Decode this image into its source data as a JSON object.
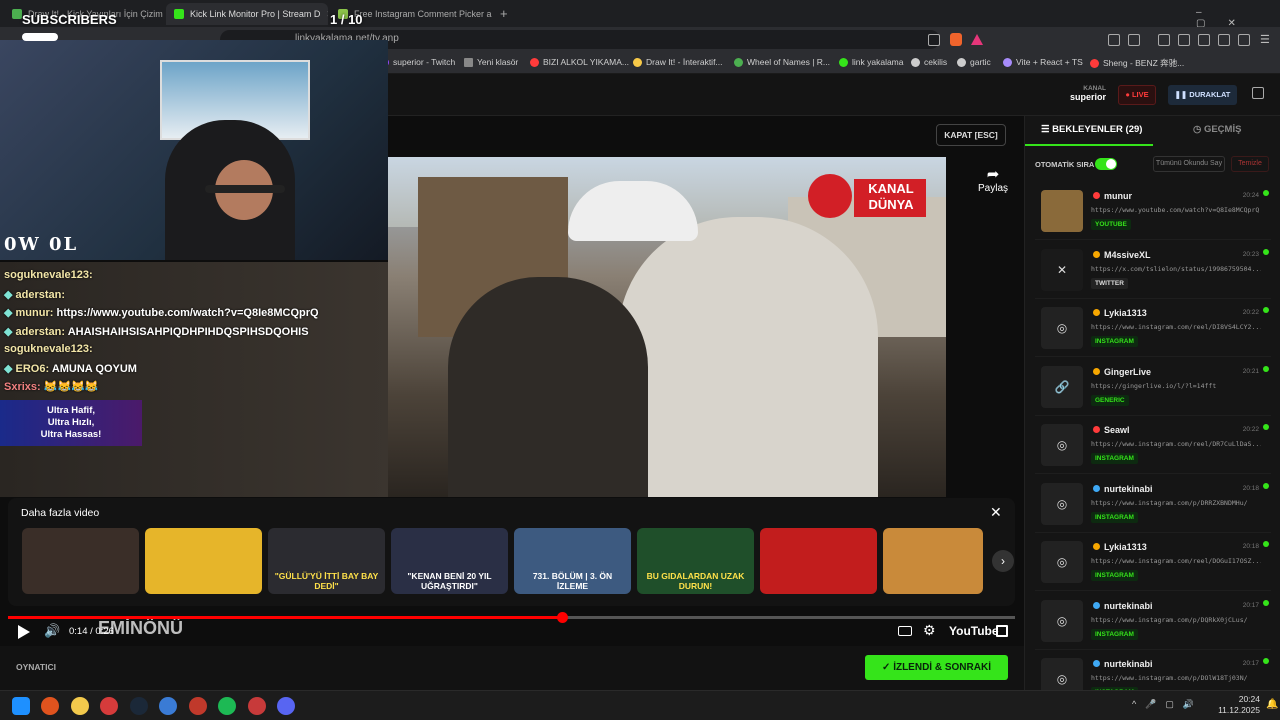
{
  "browser": {
    "tabs": [
      {
        "label": "Draw It! - Kick Yayınları İçin Çizim ve"
      },
      {
        "label": "Kick Link Monitor Pro | Stream D"
      },
      {
        "label": "Free Instagram Comment Picker and"
      }
    ],
    "new_tab": "+",
    "url": "linkyakalama.net/tv.anp",
    "bookmarks": [
      {
        "label": "superior - Twitch",
        "color": "#9146ff"
      },
      {
        "label": "Yeni klasör",
        "color": "#888888"
      },
      {
        "label": "BIZI ALKOL YIKAMA...",
        "color": "#ff3b3b"
      },
      {
        "label": "Draw It! - İnteraktif...",
        "color": "#f7c948"
      },
      {
        "label": "Wheel of Names | R...",
        "color": "#4caf50"
      },
      {
        "label": "link yakalama",
        "color": "#35e41a"
      },
      {
        "label": "cekilis",
        "color": "#cccccc"
      },
      {
        "label": "gartic",
        "color": "#cccccc"
      },
      {
        "label": "Vite + React + TS",
        "color": "#a78bfa"
      },
      {
        "label": "Sheng - BENZ 奔驰...",
        "color": "#ff3b3b"
      }
    ]
  },
  "overlay": {
    "subscribers_label": "SUBSCRIBERS",
    "subscribers_count": "1 / 10",
    "streamer_tag": "0W 0L",
    "chat": [
      {
        "user": "soguknevale123:",
        "msg": ""
      },
      {
        "user": "aderstan:",
        "msg": ""
      },
      {
        "user": "munur:",
        "msg": "https://www.youtube.com/watch?v=Q8Ie8MCQprQ"
      },
      {
        "user": "aderstan:",
        "msg": "AHAISHAIHSISAHPIQDHPIHDQSPIHSDQOHIS"
      },
      {
        "user": "soguknevale123:",
        "msg": ""
      },
      {
        "user": "ERO6:",
        "msg": "AMUNA QOYUM"
      },
      {
        "user": "Sxrixs:",
        "msg": "😹😹😹😹"
      }
    ],
    "promo": [
      "Ultra Hafif,",
      "Ultra Hızlı,",
      "Ultra Hassas!"
    ]
  },
  "header": {
    "channel_label": "KANAL",
    "channel_name": "superior",
    "live_label": "LIVE",
    "pause_label": "DURAKLAT"
  },
  "player": {
    "close_label": "KAPAT [ESC]",
    "share_label": "Paylaş",
    "video_logo": "KANAL DÜNYA",
    "more_videos_title": "Daha fazla video",
    "thumbnails": [
      {
        "text": "",
        "color": "#3a2e28"
      },
      {
        "text": "",
        "color": "#e6b52a"
      },
      {
        "text": "\"GÜLLÜ'YÜ İTTİ BAY BAY DEDİ\"",
        "color": "#2b2b30"
      },
      {
        "text": "\"KENAN BENİ 20 YIL UĞRAŞTIRDI\"",
        "color": "#2a2f45"
      },
      {
        "text": "731. BÖLÜM | 3. ÖN İZLEME",
        "color": "#3d5a80"
      },
      {
        "text": "BU GIDALARDAN UZAK DURUN!",
        "color": "#1f4f2a"
      },
      {
        "text": "",
        "color": "#c21d1d"
      },
      {
        "text": "",
        "color": "#c98a3a"
      }
    ],
    "current_time": "0:14",
    "duration": "0:26",
    "progress": 0.55,
    "youtube_label": "YouTube",
    "watermark": "EMİNÖNÜ",
    "player_label": "OYNATICI",
    "watched_next_label": "İZLENDİ & SONRAKİ"
  },
  "panel": {
    "tab_waiting": "BEKLEYENLER (29)",
    "tab_history": "GEÇMİŞ",
    "auto_queue_label": "OTOMATİK SIRA",
    "mark_all_label": "Tümünü Okundu Say",
    "clear_label": "Temizle",
    "items": [
      {
        "user": "munur",
        "url": "https://www.youtube.com/watch?v=Q8Ie8MCQprQ",
        "type": "YOUTUBE",
        "time": "20:24",
        "dot": "#ff3b3b",
        "thumb": "#8a6a3a"
      },
      {
        "user": "M4ssiveXL",
        "url": "https://x.com/tslielon/status/19986759504...",
        "type": "TWITTER",
        "time": "20:23",
        "dot": "#f7a700",
        "thumb": "#1a1a1a"
      },
      {
        "user": "Lykia1313",
        "url": "https://www.instagram.com/reel/DI8VS4LCY2...",
        "type": "INSTAGRAM",
        "time": "20:22",
        "dot": "#f7a700",
        "thumb": "#222222"
      },
      {
        "user": "GingerLive",
        "url": "https://gingerlive.io/l/?l=14fft",
        "type": "GENERIC",
        "time": "20:21",
        "dot": "#f7a700",
        "thumb": "#222222"
      },
      {
        "user": "Seawl",
        "url": "https://www.instagram.com/reel/DR7CuLlDaS...",
        "type": "INSTAGRAM",
        "time": "20:22",
        "dot": "#ff3b3b",
        "thumb": "#222222"
      },
      {
        "user": "nurtekinabi",
        "url": "https://www.instagram.com/p/DRRZXBNDMHu/",
        "type": "INSTAGRAM",
        "time": "20:18",
        "dot": "#3fa9f5",
        "thumb": "#222222"
      },
      {
        "user": "Lykia1313",
        "url": "https://www.instagram.com/reel/DOGuI17OSZ...",
        "type": "INSTAGRAM",
        "time": "20:18",
        "dot": "#f7a700",
        "thumb": "#222222"
      },
      {
        "user": "nurtekinabi",
        "url": "https://www.instagram.com/p/DQRkX0jCLus/",
        "type": "INSTAGRAM",
        "time": "20:17",
        "dot": "#3fa9f5",
        "thumb": "#222222"
      },
      {
        "user": "nurtekinabi",
        "url": "https://www.instagram.com/p/DOlW18Tj03N/",
        "type": "INSTAGRAM",
        "time": "20:17",
        "dot": "#3fa9f5",
        "thumb": "#222222"
      }
    ]
  },
  "taskbar": {
    "time": "20:24",
    "date": "11.12.2025",
    "apps": [
      "#1e90ff",
      "#e0531e",
      "#f2c94c",
      "#d63b3b",
      "#1b2838",
      "#3a7bd5",
      "#c0392b",
      "#1db954",
      "#c73a3a",
      "#5865f2"
    ]
  },
  "colors": {
    "accent": "#35e41a",
    "live": "#ff3b3b"
  }
}
